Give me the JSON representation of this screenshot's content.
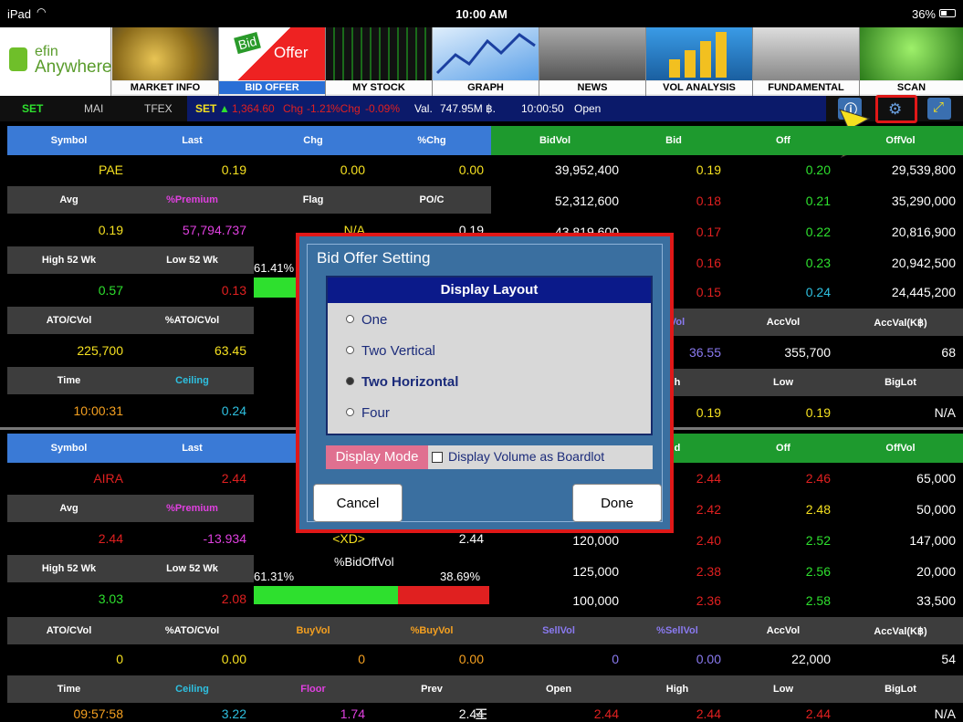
{
  "status": {
    "device": "iPad",
    "wifi": "wifi-icon",
    "time": "10:00 AM",
    "battery": "36%"
  },
  "logo": {
    "line1": "efin",
    "line2": "Anywhere"
  },
  "menu": [
    {
      "label": "MARKET INFO"
    },
    {
      "label": "BID OFFER",
      "pic_text1": "Bid",
      "pic_text2": "Offer"
    },
    {
      "label": "MY STOCK"
    },
    {
      "label": "GRAPH"
    },
    {
      "label": "NEWS"
    },
    {
      "label": "VOL ANALYSIS"
    },
    {
      "label": "FUNDAMENTAL"
    },
    {
      "label": "SCAN"
    }
  ],
  "ticker": {
    "set": "SET",
    "mai": "MAI",
    "tfex": "TFEX",
    "set2": "SET",
    "index": "1,364.60",
    "chg_label": "Chg",
    "chg": "-1.21",
    "pchg_label": "%Chg",
    "pchg": "-0.09%",
    "val_label": "Val.",
    "val": "747.95M ฿.",
    "time": "10:00:50",
    "state": "Open"
  },
  "top": {
    "h1": [
      "Symbol",
      "Last",
      "Chg",
      "%Chg"
    ],
    "r1": [
      "PAE",
      "0.19",
      "0.00",
      "0.00"
    ],
    "h2": [
      "Avg",
      "%Premium",
      "Flag",
      "PO/C"
    ],
    "r2": [
      "0.19",
      "57,794.737",
      "N/A",
      "0.19"
    ],
    "h3": [
      "High 52 Wk",
      "Low 52 Wk"
    ],
    "r3": [
      "0.57",
      "0.13"
    ],
    "pct_left": "61.41%",
    "h4": [
      "ATO/CVol",
      "%ATO/CVol"
    ],
    "r4": [
      "225,700",
      "63.45"
    ],
    "h5": [
      "Time",
      "Ceiling"
    ],
    "r5": [
      "10:00:31",
      "0.24"
    ],
    "bo_h": [
      "BidVol",
      "Bid",
      "Off",
      "OffVol"
    ],
    "bo": [
      [
        "39,952,400",
        "0.19",
        "0.20",
        "29,539,800"
      ],
      [
        "52,312,600",
        "0.18",
        "0.21",
        "35,290,000"
      ],
      [
        "43,819,600",
        "0.17",
        "0.22",
        "20,816,900"
      ],
      [
        "",
        "0.16",
        "0.23",
        "20,942,500"
      ],
      [
        "",
        "0.15",
        "0.24",
        "24,445,200"
      ]
    ],
    "bo_h2": [
      "Vol",
      "AccVol",
      "AccVal(K฿)"
    ],
    "bo_r2": [
      "36.55",
      "355,700",
      "68"
    ],
    "bo_h3": [
      "h",
      "Low",
      "BigLot"
    ],
    "bo_r3": [
      "0.19",
      "0.19",
      "N/A"
    ]
  },
  "bottom": {
    "h1": [
      "Symbol",
      "Last"
    ],
    "r1": [
      "AIRA",
      "2.44"
    ],
    "h2": [
      "Avg",
      "%Premium"
    ],
    "r2": [
      "2.44",
      "-13.934",
      "<XD>",
      "2.44"
    ],
    "h3": [
      "High 52 Wk",
      "Low 52 Wk"
    ],
    "r3": [
      "3.03",
      "2.08"
    ],
    "pct_left": "61.31%",
    "pct_title": "%BidOffVol",
    "pct_right": "38.69%",
    "h4": [
      "ATO/CVol",
      "%ATO/CVol",
      "BuyVol",
      "%BuyVol",
      "SellVol",
      "%SellVol",
      "AccVol",
      "AccVal(K฿)"
    ],
    "r4": [
      "0",
      "0.00",
      "0",
      "0.00",
      "0",
      "0.00",
      "22,000",
      "54"
    ],
    "h5": [
      "Time",
      "Ceiling",
      "Floor",
      "Prev",
      "Open",
      "High",
      "Low",
      "BigLot"
    ],
    "r5": [
      "09:57:58",
      "3.22",
      "1.74",
      "2.44",
      "2.44",
      "2.44",
      "2.44",
      "N/A"
    ],
    "bo_h": [
      "d",
      "Off",
      "OffVol"
    ],
    "bo": [
      [
        "",
        "2.44",
        "2.46",
        "65,000"
      ],
      [
        "",
        "2.42",
        "2.48",
        "50,000"
      ],
      [
        "120,000",
        "2.40",
        "2.52",
        "147,000"
      ],
      [
        "125,000",
        "2.38",
        "2.56",
        "20,000"
      ],
      [
        "100,000",
        "2.36",
        "2.58",
        "33,500"
      ]
    ]
  },
  "dialog": {
    "title": "Bid Offer Setting",
    "layout_heading": "Display Layout",
    "options": [
      "One",
      "Two Vertical",
      "Two Horizontal",
      "Four"
    ],
    "selected": "Two Horizontal",
    "mode_label": "Display Mode",
    "mode_checkbox": "Display Volume as Boardlot",
    "mode_checked": false,
    "cancel": "Cancel",
    "done": "Done"
  },
  "colors": {
    "green_header": "#1e9a2e",
    "blue_header": "#3a7ad6",
    "highlight": "#e01818"
  }
}
